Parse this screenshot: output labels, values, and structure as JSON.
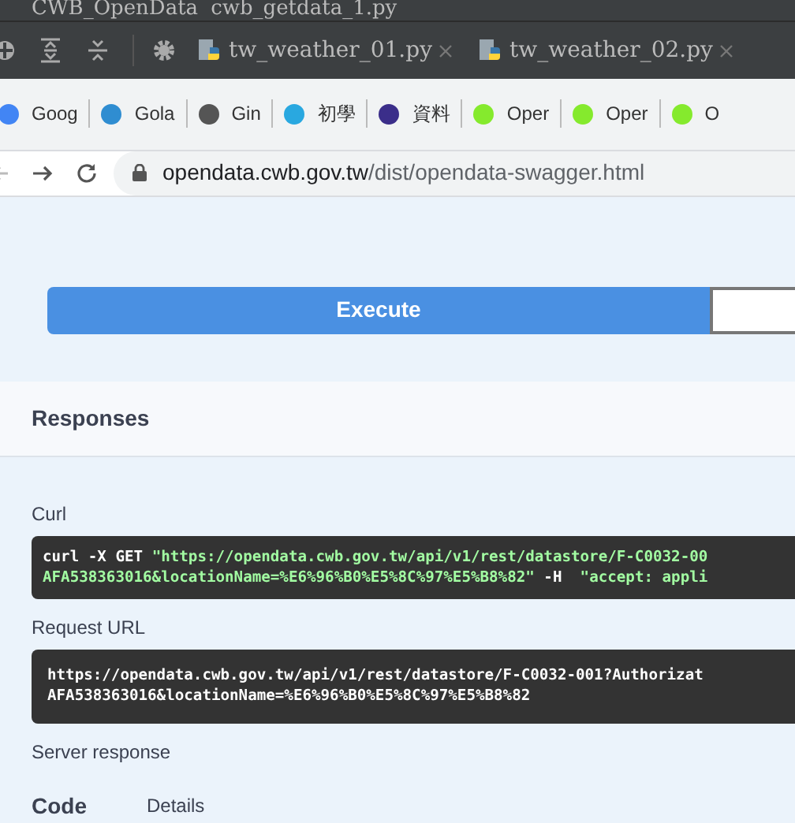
{
  "breadcrumb": [
    "CWB_OpenData",
    "cwb_getdata_1.py"
  ],
  "editor_tabs": [
    {
      "label": "tw_weather_01.py",
      "selected": false
    },
    {
      "label": "tw_weather_02.py",
      "selected": false
    }
  ],
  "bookmarks": [
    {
      "label": "Goog",
      "color": "#4285f4"
    },
    {
      "label": "Gola",
      "color": "#2f8dd1"
    },
    {
      "label": "Gin",
      "color": "#555555"
    },
    {
      "label": "初學",
      "color": "#29a8e0"
    },
    {
      "label": "資料",
      "color": "#3b2e8a"
    },
    {
      "label": "Oper",
      "color": "#85ea2d"
    },
    {
      "label": "Oper",
      "color": "#85ea2d"
    },
    {
      "label": "O",
      "color": "#85ea2d"
    }
  ],
  "address_bar": {
    "host": "opendata.cwb.gov.tw",
    "path": "/dist/opendata-swagger.html"
  },
  "execute_button": "Execute",
  "responses_title": "Responses",
  "curl": {
    "label": "Curl",
    "lines": [
      [
        {
          "kind": "command",
          "text": "curl -X GET "
        },
        {
          "kind": "string",
          "text": "\"https://opendata.cwb.gov.tw/api/v1/rest/datastore/F-C0032-00"
        }
      ],
      [
        {
          "kind": "string",
          "text": "AFA538363016&locationName=%E6%96%B0%E5%8C%97%E5%B8%82\""
        },
        {
          "kind": "command",
          "text": " -H  "
        },
        {
          "kind": "string",
          "text": "\"accept: appli"
        }
      ]
    ]
  },
  "request_url": {
    "label": "Request URL",
    "lines": [
      "https://opendata.cwb.gov.tw/api/v1/rest/datastore/F-C0032-001?Authorizat",
      "AFA538363016&locationName=%E6%96%B0%E5%8C%97%E5%B8%82"
    ]
  },
  "server_response": {
    "label": "Server response",
    "columns": [
      "Code",
      "Details"
    ]
  }
}
